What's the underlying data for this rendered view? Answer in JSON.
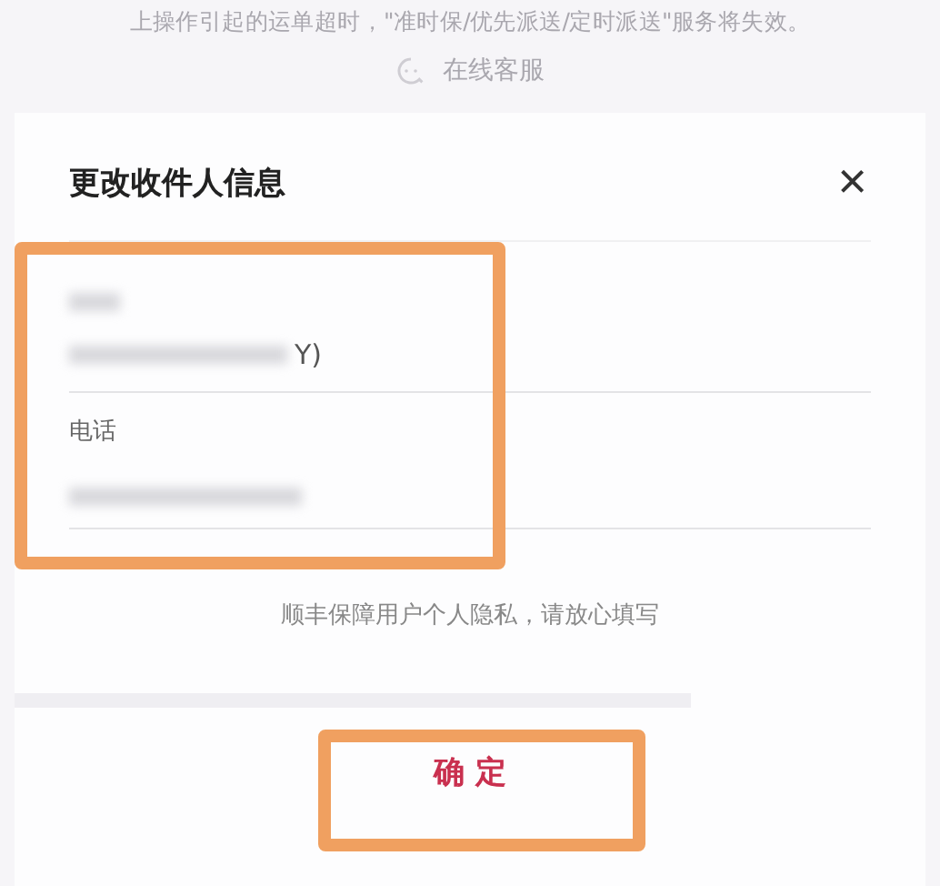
{
  "background": {
    "notice": "上操作引起的运单超时，\"准时保/优先派送/定时派送\"服务将失效。",
    "support_link": "在线客服"
  },
  "sheet": {
    "title": "更改收件人信息",
    "close": "×",
    "fields": [
      {
        "kind": "redacted",
        "label_redacted": true,
        "value_tail": "Y)"
      },
      {
        "kind": "labeled",
        "label": "电话",
        "value_redacted": true
      }
    ],
    "fields_highlighted": true,
    "privacy_note": "顺丰保障用户个人隐私，请放心填写",
    "confirm_button": {
      "label": "确 定",
      "highlighted": true
    }
  }
}
